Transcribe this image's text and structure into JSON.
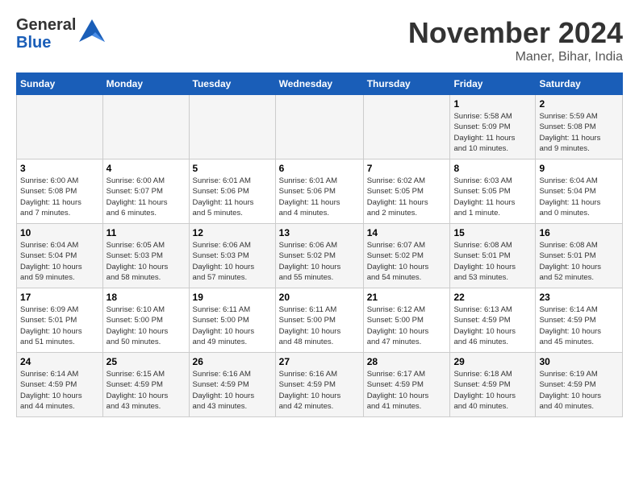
{
  "logo": {
    "general": "General",
    "blue": "Blue"
  },
  "title": "November 2024",
  "location": "Maner, Bihar, India",
  "weekdays": [
    "Sunday",
    "Monday",
    "Tuesday",
    "Wednesday",
    "Thursday",
    "Friday",
    "Saturday"
  ],
  "weeks": [
    [
      {
        "day": "",
        "text": ""
      },
      {
        "day": "",
        "text": ""
      },
      {
        "day": "",
        "text": ""
      },
      {
        "day": "",
        "text": ""
      },
      {
        "day": "",
        "text": ""
      },
      {
        "day": "1",
        "text": "Sunrise: 5:58 AM\nSunset: 5:09 PM\nDaylight: 11 hours\nand 10 minutes."
      },
      {
        "day": "2",
        "text": "Sunrise: 5:59 AM\nSunset: 5:08 PM\nDaylight: 11 hours\nand 9 minutes."
      }
    ],
    [
      {
        "day": "3",
        "text": "Sunrise: 6:00 AM\nSunset: 5:08 PM\nDaylight: 11 hours\nand 7 minutes."
      },
      {
        "day": "4",
        "text": "Sunrise: 6:00 AM\nSunset: 5:07 PM\nDaylight: 11 hours\nand 6 minutes."
      },
      {
        "day": "5",
        "text": "Sunrise: 6:01 AM\nSunset: 5:06 PM\nDaylight: 11 hours\nand 5 minutes."
      },
      {
        "day": "6",
        "text": "Sunrise: 6:01 AM\nSunset: 5:06 PM\nDaylight: 11 hours\nand 4 minutes."
      },
      {
        "day": "7",
        "text": "Sunrise: 6:02 AM\nSunset: 5:05 PM\nDaylight: 11 hours\nand 2 minutes."
      },
      {
        "day": "8",
        "text": "Sunrise: 6:03 AM\nSunset: 5:05 PM\nDaylight: 11 hours\nand 1 minute."
      },
      {
        "day": "9",
        "text": "Sunrise: 6:04 AM\nSunset: 5:04 PM\nDaylight: 11 hours\nand 0 minutes."
      }
    ],
    [
      {
        "day": "10",
        "text": "Sunrise: 6:04 AM\nSunset: 5:04 PM\nDaylight: 10 hours\nand 59 minutes."
      },
      {
        "day": "11",
        "text": "Sunrise: 6:05 AM\nSunset: 5:03 PM\nDaylight: 10 hours\nand 58 minutes."
      },
      {
        "day": "12",
        "text": "Sunrise: 6:06 AM\nSunset: 5:03 PM\nDaylight: 10 hours\nand 57 minutes."
      },
      {
        "day": "13",
        "text": "Sunrise: 6:06 AM\nSunset: 5:02 PM\nDaylight: 10 hours\nand 55 minutes."
      },
      {
        "day": "14",
        "text": "Sunrise: 6:07 AM\nSunset: 5:02 PM\nDaylight: 10 hours\nand 54 minutes."
      },
      {
        "day": "15",
        "text": "Sunrise: 6:08 AM\nSunset: 5:01 PM\nDaylight: 10 hours\nand 53 minutes."
      },
      {
        "day": "16",
        "text": "Sunrise: 6:08 AM\nSunset: 5:01 PM\nDaylight: 10 hours\nand 52 minutes."
      }
    ],
    [
      {
        "day": "17",
        "text": "Sunrise: 6:09 AM\nSunset: 5:01 PM\nDaylight: 10 hours\nand 51 minutes."
      },
      {
        "day": "18",
        "text": "Sunrise: 6:10 AM\nSunset: 5:00 PM\nDaylight: 10 hours\nand 50 minutes."
      },
      {
        "day": "19",
        "text": "Sunrise: 6:11 AM\nSunset: 5:00 PM\nDaylight: 10 hours\nand 49 minutes."
      },
      {
        "day": "20",
        "text": "Sunrise: 6:11 AM\nSunset: 5:00 PM\nDaylight: 10 hours\nand 48 minutes."
      },
      {
        "day": "21",
        "text": "Sunrise: 6:12 AM\nSunset: 5:00 PM\nDaylight: 10 hours\nand 47 minutes."
      },
      {
        "day": "22",
        "text": "Sunrise: 6:13 AM\nSunset: 4:59 PM\nDaylight: 10 hours\nand 46 minutes."
      },
      {
        "day": "23",
        "text": "Sunrise: 6:14 AM\nSunset: 4:59 PM\nDaylight: 10 hours\nand 45 minutes."
      }
    ],
    [
      {
        "day": "24",
        "text": "Sunrise: 6:14 AM\nSunset: 4:59 PM\nDaylight: 10 hours\nand 44 minutes."
      },
      {
        "day": "25",
        "text": "Sunrise: 6:15 AM\nSunset: 4:59 PM\nDaylight: 10 hours\nand 43 minutes."
      },
      {
        "day": "26",
        "text": "Sunrise: 6:16 AM\nSunset: 4:59 PM\nDaylight: 10 hours\nand 43 minutes."
      },
      {
        "day": "27",
        "text": "Sunrise: 6:16 AM\nSunset: 4:59 PM\nDaylight: 10 hours\nand 42 minutes."
      },
      {
        "day": "28",
        "text": "Sunrise: 6:17 AM\nSunset: 4:59 PM\nDaylight: 10 hours\nand 41 minutes."
      },
      {
        "day": "29",
        "text": "Sunrise: 6:18 AM\nSunset: 4:59 PM\nDaylight: 10 hours\nand 40 minutes."
      },
      {
        "day": "30",
        "text": "Sunrise: 6:19 AM\nSunset: 4:59 PM\nDaylight: 10 hours\nand 40 minutes."
      }
    ]
  ]
}
